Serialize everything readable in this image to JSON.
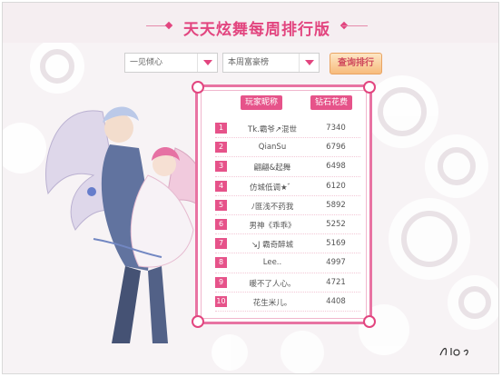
{
  "header": {
    "title": "天天炫舞每周排行版"
  },
  "filters": {
    "select1": "一见倾心",
    "select2": "本周富豪榜",
    "query_button": "查询排行"
  },
  "ranking": {
    "columns": [
      "玩家昵称",
      "钻石花费"
    ],
    "rows": [
      {
        "rank": "1",
        "name": "Tk.霸爷↗混世",
        "value": "7340"
      },
      {
        "rank": "2",
        "name": "QianSu",
        "value": "6796"
      },
      {
        "rank": "3",
        "name": "翩翩&起舞",
        "value": "6498"
      },
      {
        "rank": "4",
        "name": "仿城低调★゛",
        "value": "6120"
      },
      {
        "rank": "5",
        "name": "ﾉ匪浅不药我",
        "value": "5892"
      },
      {
        "rank": "6",
        "name": "男神《乖乖》",
        "value": "5252"
      },
      {
        "rank": "7",
        "name": "↘J 霸奇醉城",
        "value": "5169"
      },
      {
        "rank": "8",
        "name": "Lee..",
        "value": "4997"
      },
      {
        "rank": "9",
        "name": "暖不了人心。",
        "value": "4721"
      },
      {
        "rank": "10",
        "name": "花生米儿。",
        "value": "4408"
      }
    ]
  },
  "colors": {
    "accent": "#e6538a",
    "title": "#e2457f",
    "button": "#f7bb7c"
  }
}
